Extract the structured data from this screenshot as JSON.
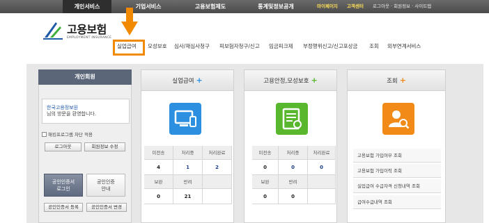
{
  "top_tabs": [
    "개인서비스",
    "기업서비스",
    "고용보험제도",
    "통계및정보공개"
  ],
  "top_util": {
    "mypage": "마이페이지",
    "customer_center": "고객센터",
    "links": "로그아웃 · 회원정보 · 사이트맵"
  },
  "logo": {
    "name": "고용보험",
    "subtitle": "EMPLOYMENT INSURANCE"
  },
  "gnb": [
    "실업급여",
    "모성보호",
    "심사/재심사청구",
    "피보험자청구/신고",
    "임금피크제",
    "부정행위신고/신고포상금",
    "조회",
    "외부연계서비스"
  ],
  "member": {
    "title": "개인회원",
    "welcome_line1": "한국고용정보원",
    "welcome_line2": "님의 방문을 환영합니다.",
    "keyboard_label": "해킹프로그램 차단 적용",
    "logout": "로그아웃",
    "info_edit": "회원정보 수정",
    "cert_login_1": "공인인증서",
    "cert_login_2": "로그인",
    "cert_guide_1": "공인인증",
    "cert_guide_2": "안내",
    "cert_register": "공인인증서 등록",
    "cert_change": "공인인증서 변경"
  },
  "panels": [
    {
      "title": "실업급여",
      "plus": "+",
      "icon": "monitor-device-icon",
      "color": "#2c8fe0",
      "heads1": [
        "미전송",
        "처리중",
        "처리완료"
      ],
      "vals1": [
        "4",
        "1",
        "2"
      ],
      "heads2": [
        "보완",
        "반려",
        ""
      ],
      "vals2": [
        "0",
        "21",
        ""
      ]
    },
    {
      "title": "고용안정,모성보호",
      "plus": "+",
      "icon": "document-edit-icon",
      "color": "#58b72d",
      "heads1": [
        "미전송",
        "처리중",
        "처리완료"
      ],
      "vals1": [
        "0",
        "0",
        "0"
      ],
      "heads2": [
        "보완",
        "반려",
        ""
      ],
      "vals2": [
        "0",
        "0",
        ""
      ]
    },
    {
      "title": "조회",
      "plus": "+",
      "icon": "user-search-icon",
      "color": "#f28a18",
      "items": [
        "고용보험 가입여부 조회",
        "고용보험 가입이력 조회",
        "실업급여 수급자격 신청내역 조회",
        "급여수급내역 조회"
      ]
    }
  ],
  "colors": {
    "highlight": "#f28a00",
    "accent_blue": "#2c8fe0",
    "accent_green": "#58b72d",
    "accent_orange": "#f28a18"
  }
}
